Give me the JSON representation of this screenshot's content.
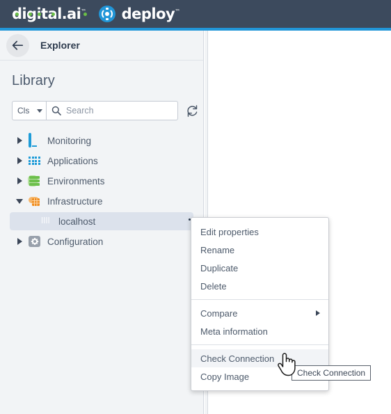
{
  "brand": {
    "product_name": "digital.ai",
    "product_tm": "™",
    "module_name": "deploy",
    "module_tm": "™",
    "deploy_icon": "deploy-target-icon",
    "bar_color": "#3c4a5d",
    "accent_color": "#2196d8",
    "dot_color": "#6bbf47"
  },
  "sidebar": {
    "back_icon": "back-arrow-icon",
    "header_title": "Explorer",
    "section_title": "Library",
    "search": {
      "filter_label": "Cls",
      "caret_icon": "chevron-down-icon",
      "search_icon": "search-icon",
      "placeholder": "Search",
      "value": "",
      "refresh_icon": "refresh-icon"
    },
    "tree": [
      {
        "label": "Monitoring",
        "icon": "monitor-icon",
        "expanded": false,
        "indent": 0,
        "selected": false
      },
      {
        "label": "Applications",
        "icon": "grid-apps-icon",
        "expanded": false,
        "indent": 0,
        "selected": false
      },
      {
        "label": "Environments",
        "icon": "server-stack-icon",
        "expanded": false,
        "indent": 0,
        "selected": false
      },
      {
        "label": "Infrastructure",
        "icon": "infrastructure-icon",
        "expanded": true,
        "indent": 0,
        "selected": false
      },
      {
        "label": "localhost",
        "icon": "host-icon",
        "expanded": null,
        "indent": 1,
        "selected": true
      },
      {
        "label": "Configuration",
        "icon": "gear-icon",
        "expanded": false,
        "indent": 0,
        "selected": false
      }
    ]
  },
  "context_menu": {
    "groups": [
      {
        "items": [
          {
            "label": "Edit properties",
            "submenu": false,
            "hovered": false
          },
          {
            "label": "Rename",
            "submenu": false,
            "hovered": false
          },
          {
            "label": "Duplicate",
            "submenu": false,
            "hovered": false
          },
          {
            "label": "Delete",
            "submenu": false,
            "hovered": false
          }
        ]
      },
      {
        "items": [
          {
            "label": "Compare",
            "submenu": true,
            "hovered": false
          },
          {
            "label": "Meta information",
            "submenu": false,
            "hovered": false
          }
        ]
      },
      {
        "items": [
          {
            "label": "Check Connection",
            "submenu": false,
            "hovered": true
          },
          {
            "label": "Copy Image",
            "submenu": false,
            "hovered": false
          }
        ]
      }
    ]
  },
  "tooltip": {
    "text": "Check Connection"
  },
  "cursor": {
    "icon": "pointing-hand-cursor"
  }
}
